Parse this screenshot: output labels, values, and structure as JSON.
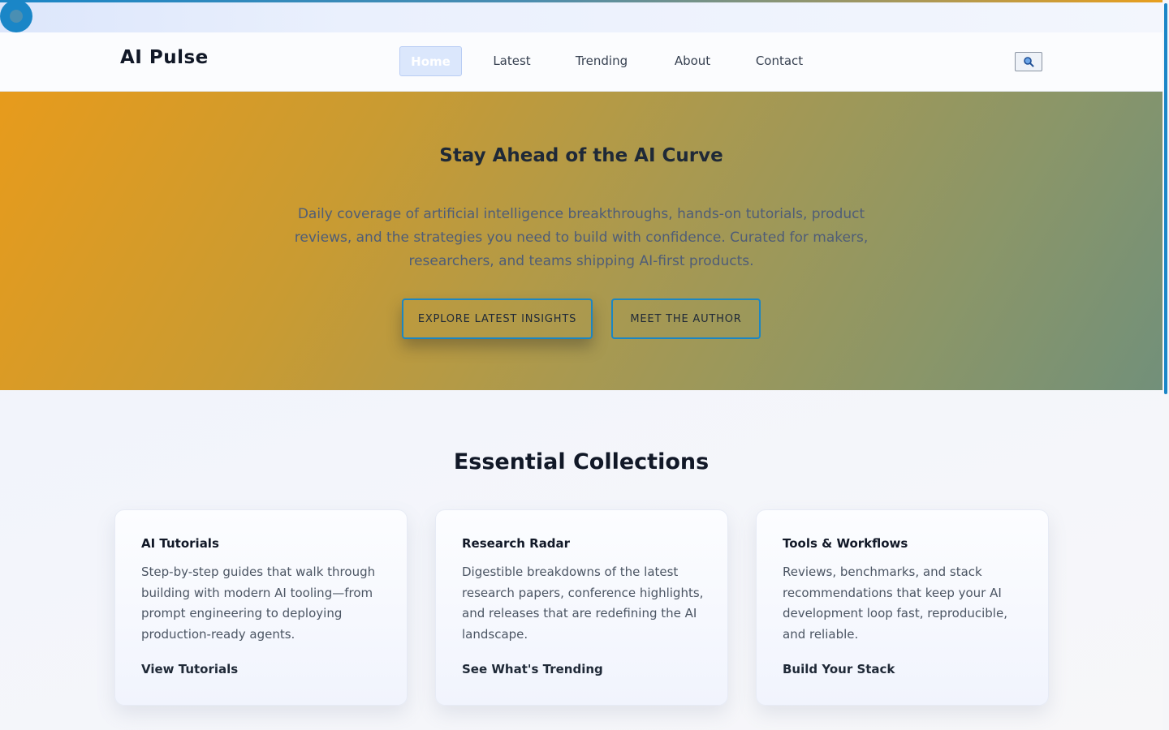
{
  "brand": {
    "logo": "AI Pulse"
  },
  "nav": {
    "items": [
      {
        "label": "Home",
        "active": true
      },
      {
        "label": "Latest"
      },
      {
        "label": "Trending"
      },
      {
        "label": "About"
      },
      {
        "label": "Contact"
      }
    ],
    "search_icon": "search-icon"
  },
  "hero": {
    "title": "Stay Ahead of the AI Curve",
    "text": "Daily coverage of artificial intelligence breakthroughs, hands-on tutorials, product reviews, and the strategies you need to build with confidence. Curated for makers, researchers, and teams shipping AI-first products.",
    "primary_cta": "EXPLORE LATEST INSIGHTS",
    "secondary_cta": "MEET THE AUTHOR"
  },
  "collections": {
    "title": "Essential Collections",
    "cards": [
      {
        "title": "AI Tutorials",
        "text": "Step-by-step guides that walk through building with modern AI tooling—from prompt engineering to deploying production-ready agents.",
        "link": "View Tutorials"
      },
      {
        "title": "Research Radar",
        "text": "Digestible breakdowns of the latest research papers, conference highlights, and releases that are redefining the AI landscape.",
        "link": "See What's Trending"
      },
      {
        "title": "Tools & Workflows",
        "text": "Reviews, benchmarks, and stack recommendations that keep your AI development loop fast, reproducible, and reliable.",
        "link": "Build Your Stack"
      }
    ]
  },
  "colors": {
    "accent": "#1a86c7",
    "hero_start": "#e79b1c",
    "hero_end": "#72907a"
  }
}
